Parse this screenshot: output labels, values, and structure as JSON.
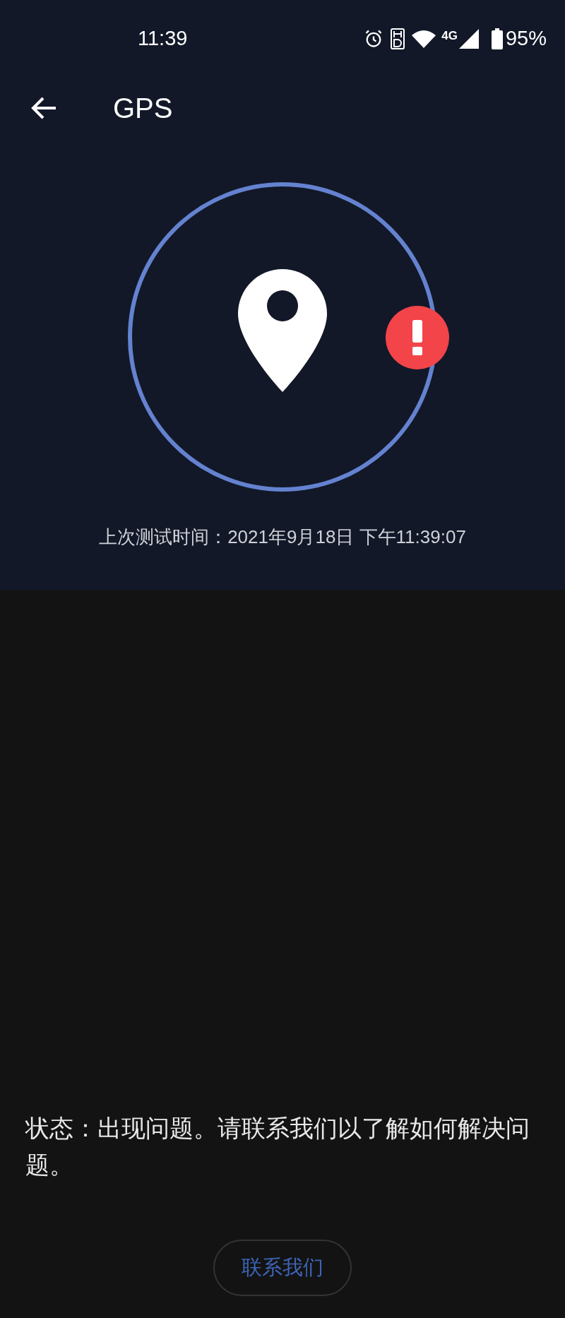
{
  "status_bar": {
    "time": "11:39",
    "network": "4G",
    "battery": "95%"
  },
  "header": {
    "title": "GPS"
  },
  "test": {
    "error": true,
    "last_test": "上次测试时间：2021年9月18日 下午11:39:07"
  },
  "status_message": "状态：出现问题。请联系我们以了解如何解决问题。",
  "contact_button": "联系我们"
}
